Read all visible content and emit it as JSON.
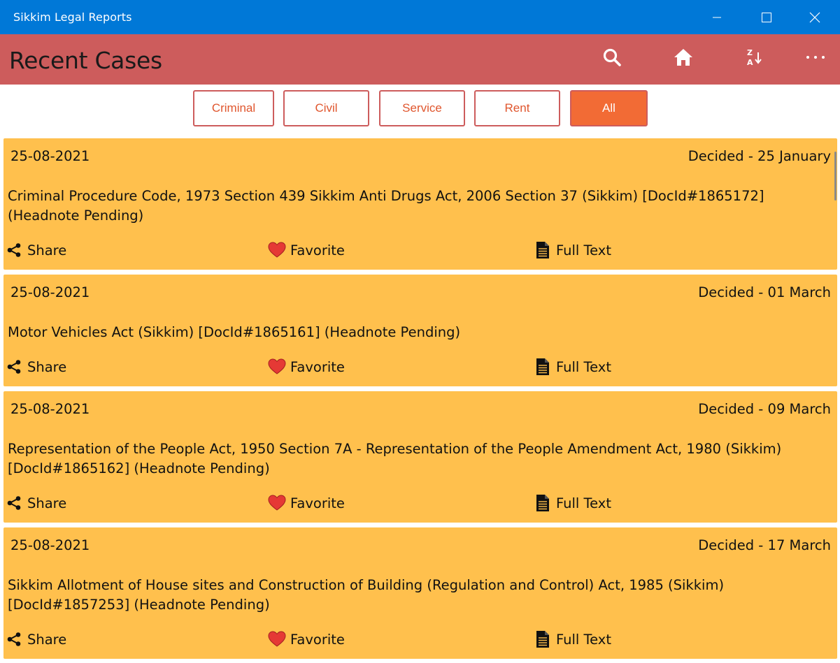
{
  "window": {
    "title": "Sikkim Legal Reports"
  },
  "header": {
    "title": "Recent Cases",
    "icons": [
      "search-icon",
      "home-icon",
      "sort-za-icon",
      "more-icon"
    ]
  },
  "filters": [
    {
      "label": "Criminal",
      "active": false
    },
    {
      "label": "Civil",
      "active": false
    },
    {
      "label": "Service",
      "active": false
    },
    {
      "label": "Rent",
      "active": false
    },
    {
      "label": "All",
      "active": true
    }
  ],
  "actions": {
    "share": "Share",
    "favorite": "Favorite",
    "full_text": "Full Text"
  },
  "cases": [
    {
      "date": "25-08-2021",
      "decided": "Decided - 25 January",
      "description": "Criminal Procedure Code, 1973 Section 439 Sikkim Anti Drugs Act, 2006 Section 37 (Sikkim) [DocId#1865172] (Headnote Pending)"
    },
    {
      "date": "25-08-2021",
      "decided": "Decided - 01 March",
      "description": "Motor Vehicles Act (Sikkim) [DocId#1865161] (Headnote Pending)"
    },
    {
      "date": "25-08-2021",
      "decided": "Decided - 09 March",
      "description": "Representation of the People Act, 1950 Section 7A - Representation of the People Amendment Act, 1980 (Sikkim) [DocId#1865162] (Headnote Pending)"
    },
    {
      "date": "25-08-2021",
      "decided": "Decided - 17 March",
      "description": "Sikkim Allotment of House sites and Construction of Building (Regulation and Control) Act, 1985 (Sikkim) [DocId#1857253] (Headnote Pending)"
    }
  ],
  "colors": {
    "titlebar": "#0078d7",
    "header": "#cd5c5c",
    "card": "#ffc04d",
    "active_filter": "#f26b35",
    "filter_text": "#e0562e",
    "heart": "#e53935"
  }
}
